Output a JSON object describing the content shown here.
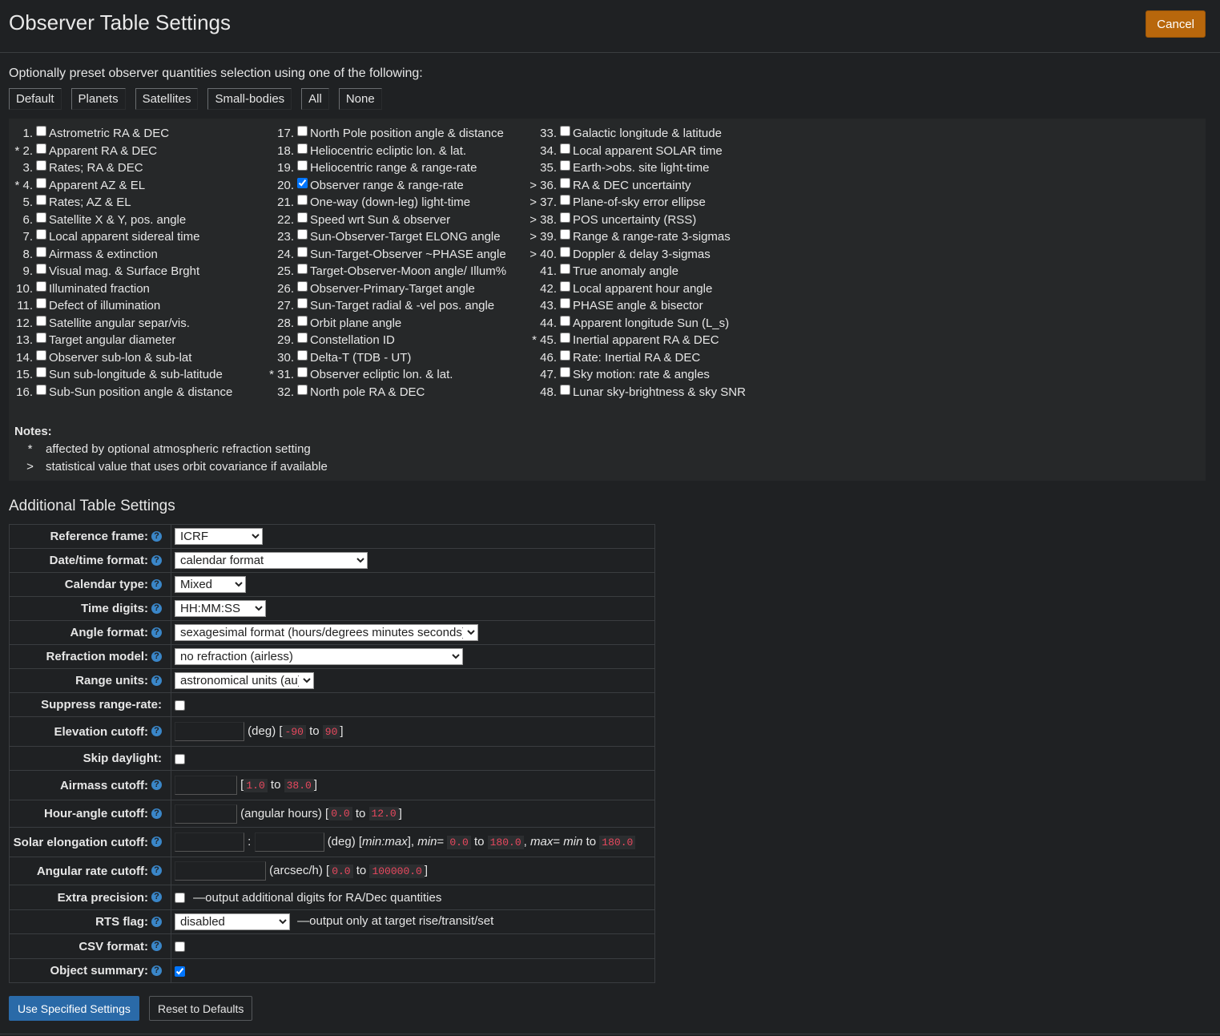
{
  "header": {
    "title": "Observer Table Settings",
    "cancel_label": "Cancel"
  },
  "preset": {
    "text": "Optionally preset observer quantities selection using one of the following:",
    "buttons": [
      "Default",
      "Planets",
      "Satellites",
      "Small-bodies",
      "All",
      "None"
    ]
  },
  "quantities": [
    [
      {
        "num": "1.",
        "label": "Astrometric RA & DEC",
        "checked": false
      },
      {
        "num": "* 2.",
        "label": "Apparent RA & DEC",
        "checked": false
      },
      {
        "num": "3.",
        "label": "Rates; RA & DEC",
        "checked": false
      },
      {
        "num": "* 4.",
        "label": "Apparent AZ & EL",
        "checked": false
      },
      {
        "num": "5.",
        "label": "Rates; AZ & EL",
        "checked": false
      },
      {
        "num": "6.",
        "label": "Satellite X & Y, pos. angle",
        "checked": false
      },
      {
        "num": "7.",
        "label": "Local apparent sidereal time",
        "checked": false
      },
      {
        "num": "8.",
        "label": "Airmass & extinction",
        "checked": false
      },
      {
        "num": "9.",
        "label": "Visual mag. & Surface Brght",
        "checked": false
      },
      {
        "num": "10.",
        "label": "Illuminated fraction",
        "checked": false
      },
      {
        "num": "11.",
        "label": "Defect of illumination",
        "checked": false
      },
      {
        "num": "12.",
        "label": "Satellite angular separ/vis.",
        "checked": false
      },
      {
        "num": "13.",
        "label": "Target angular diameter",
        "checked": false
      },
      {
        "num": "14.",
        "label": "Observer sub-lon & sub-lat",
        "checked": false
      },
      {
        "num": "15.",
        "label": "Sun sub-longitude & sub-latitude",
        "checked": false
      },
      {
        "num": "16.",
        "label": "Sub-Sun position angle & distance",
        "checked": false
      }
    ],
    [
      {
        "num": "17.",
        "label": "North Pole position angle & distance",
        "checked": false
      },
      {
        "num": "18.",
        "label": "Heliocentric ecliptic lon. & lat.",
        "checked": false
      },
      {
        "num": "19.",
        "label": "Heliocentric range & range-rate",
        "checked": false
      },
      {
        "num": "20.",
        "label": "Observer range & range-rate",
        "checked": true
      },
      {
        "num": "21.",
        "label": "One-way (down-leg) light-time",
        "checked": false
      },
      {
        "num": "22.",
        "label": "Speed wrt Sun & observer",
        "checked": false
      },
      {
        "num": "23.",
        "label": "Sun-Observer-Target ELONG angle",
        "checked": false
      },
      {
        "num": "24.",
        "label": "Sun-Target-Observer ~PHASE angle",
        "checked": false
      },
      {
        "num": "25.",
        "label": "Target-Observer-Moon angle/ Illum%",
        "checked": false
      },
      {
        "num": "26.",
        "label": "Observer-Primary-Target angle",
        "checked": false
      },
      {
        "num": "27.",
        "label": "Sun-Target radial & -vel pos. angle",
        "checked": false
      },
      {
        "num": "28.",
        "label": "Orbit plane angle",
        "checked": false
      },
      {
        "num": "29.",
        "label": "Constellation ID",
        "checked": false
      },
      {
        "num": "30.",
        "label": "Delta-T (TDB - UT)",
        "checked": false
      },
      {
        "num": "* 31.",
        "label": "Observer ecliptic lon. & lat.",
        "checked": false
      },
      {
        "num": "32.",
        "label": "North pole RA & DEC",
        "checked": false
      }
    ],
    [
      {
        "num": "33.",
        "label": "Galactic longitude & latitude",
        "checked": false
      },
      {
        "num": "34.",
        "label": "Local apparent SOLAR time",
        "checked": false
      },
      {
        "num": "35.",
        "label": "Earth->obs. site light-time",
        "checked": false
      },
      {
        "num": "> 36.",
        "label": "RA & DEC uncertainty",
        "checked": false
      },
      {
        "num": "> 37.",
        "label": "Plane-of-sky error ellipse",
        "checked": false
      },
      {
        "num": "> 38.",
        "label": "POS uncertainty (RSS)",
        "checked": false
      },
      {
        "num": "> 39.",
        "label": "Range & range-rate 3-sigmas",
        "checked": false
      },
      {
        "num": "> 40.",
        "label": "Doppler & delay 3-sigmas",
        "checked": false
      },
      {
        "num": "41.",
        "label": "True anomaly angle",
        "checked": false
      },
      {
        "num": "42.",
        "label": "Local apparent hour angle",
        "checked": false
      },
      {
        "num": "43.",
        "label": "PHASE angle & bisector",
        "checked": false
      },
      {
        "num": "44.",
        "label": "Apparent longitude Sun (L_s)",
        "checked": false
      },
      {
        "num": "* 45.",
        "label": "Inertial apparent RA & DEC",
        "checked": false
      },
      {
        "num": "46.",
        "label": "Rate: Inertial RA & DEC",
        "checked": false
      },
      {
        "num": "47.",
        "label": "Sky motion: rate & angles",
        "checked": false
      },
      {
        "num": "48.",
        "label": "Lunar sky-brightness & sky SNR",
        "checked": false
      }
    ]
  ],
  "notes": {
    "title": "Notes:",
    "items": [
      {
        "symbol": "*",
        "text": "affected by optional atmospheric refraction setting"
      },
      {
        "symbol": ">",
        "text": "statistical value that uses orbit covariance if available"
      }
    ]
  },
  "additional": {
    "title": "Additional Table Settings",
    "help_glyph": "?",
    "reference_frame": {
      "label": "Reference frame:",
      "value": "ICRF"
    },
    "datetime_format": {
      "label": "Date/time format:",
      "value": "calendar format"
    },
    "calendar_type": {
      "label": "Calendar type:",
      "value": "Mixed"
    },
    "time_digits": {
      "label": "Time digits:",
      "value": "HH:MM:SS"
    },
    "angle_format": {
      "label": "Angle format:",
      "value": "sexagesimal format (hours/degrees minutes seconds)"
    },
    "refraction_model": {
      "label": "Refraction model:",
      "value": "no refraction (airless)"
    },
    "range_units": {
      "label": "Range units:",
      "value": "astronomical units (au)"
    },
    "suppress_range_rate": {
      "label": "Suppress range-rate:",
      "checked": false
    },
    "elevation_cutoff": {
      "label": "Elevation cutoff:",
      "unit": "(deg) [",
      "min": "-90",
      "to": "to",
      "max": "90",
      "close": "]"
    },
    "skip_daylight": {
      "label": "Skip daylight:",
      "checked": false
    },
    "airmass_cutoff": {
      "label": "Airmass cutoff:",
      "open": "[",
      "min": "1.0",
      "to": "to",
      "max": "38.0",
      "close": "]"
    },
    "hour_angle_cutoff": {
      "label": "Hour-angle cutoff:",
      "unit": "(angular hours) [",
      "min": "0.0",
      "to": "to",
      "max": "12.0",
      "close": "]"
    },
    "solar_elongation_cutoff": {
      "label": "Solar elongation cutoff:",
      "sep": ":",
      "unit_open": "(deg) [",
      "minmax": "min:max",
      "close_min": "], ",
      "min_label": "min",
      "eq": "=",
      "min_lo": "0.0",
      "to": "to",
      "min_hi": "180.0",
      "comma": ",",
      "max_label": "max",
      "eq2": "=",
      "min_word": "min",
      "to2": "to",
      "max_hi": "180.0"
    },
    "angular_rate_cutoff": {
      "label": "Angular rate cutoff:",
      "unit": "(arcsec/h) [",
      "min": "0.0",
      "to": "to",
      "max": "100000.0",
      "close": "]"
    },
    "extra_precision": {
      "label": "Extra precision:",
      "checked": false,
      "note": "—output additional digits for RA/Dec quantities"
    },
    "rts_flag": {
      "label": "RTS flag:",
      "value": "disabled",
      "note": "—output only at target rise/transit/set"
    },
    "csv_format": {
      "label": "CSV format:",
      "checked": false
    },
    "object_summary": {
      "label": "Object summary:",
      "checked": true
    }
  },
  "footer": {
    "use_label": "Use Specified Settings",
    "reset_label": "Reset to Defaults"
  },
  "colors": {
    "accent_orange": "#b8670c",
    "primary_blue": "#2a6aa8",
    "help_blue": "#3a86c8",
    "code_red": "#e8485e"
  }
}
